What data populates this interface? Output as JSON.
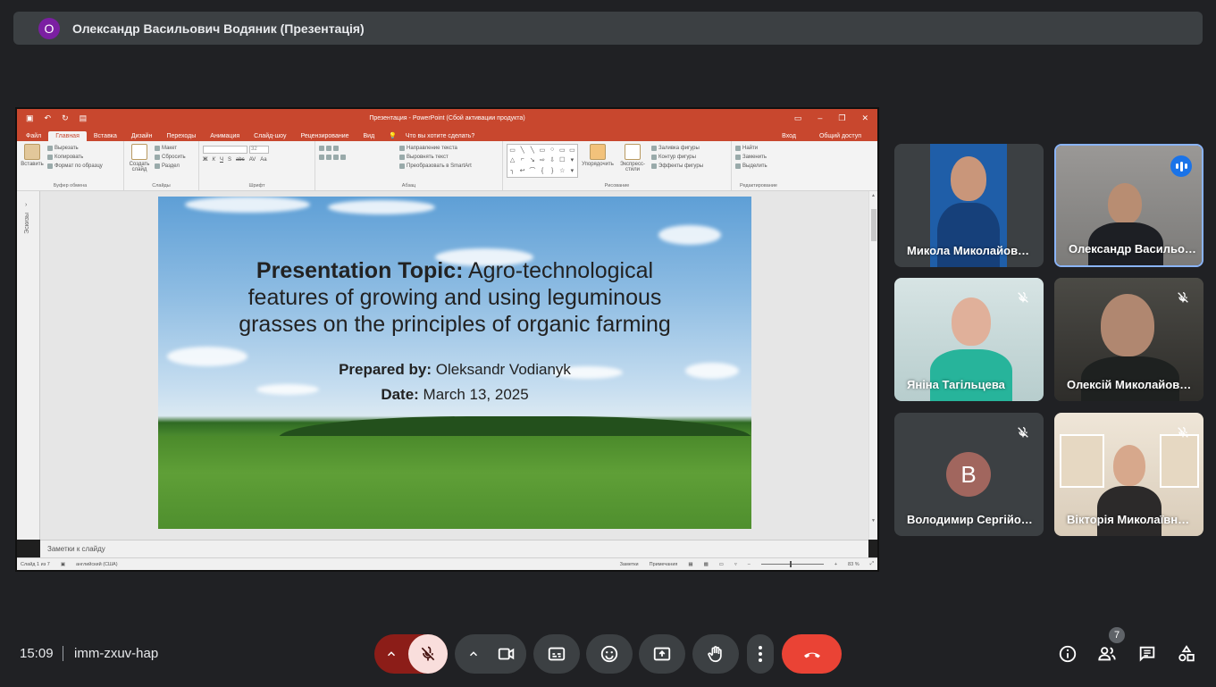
{
  "banner": {
    "avatar_letter": "О",
    "title": "Олександр Васильович Водяник (Презентація)"
  },
  "ppt": {
    "window_title": "Презентация - PowerPoint (Сбой активации продукта)",
    "tabs": [
      "Файл",
      "Главная",
      "Вставка",
      "Дизайн",
      "Переходы",
      "Анимация",
      "Слайд-шоу",
      "Рецензирование",
      "Вид",
      "Что вы хотите сделать?"
    ],
    "tabs_right": [
      "Вход",
      "Общий доступ"
    ],
    "clipboard": {
      "paste": "Вставить",
      "cut": "Вырезать",
      "copy": "Копировать",
      "format": "Формат по образцу",
      "label": "Буфер обмена"
    },
    "slides": {
      "new": "Создать слайд",
      "layout": "Макет",
      "reset": "Сбросить",
      "section": "Раздел",
      "label": "Слайды"
    },
    "font": {
      "size": "32",
      "label": "Шрифт",
      "bold": "Ж",
      "italic": "К",
      "underline": "Ч",
      "shadow": "S",
      "strike": "abc",
      "spacing": "AV",
      "case": "Aa"
    },
    "paragraph": {
      "direction": "Направление текста",
      "align": "Выровнять текст",
      "smartart": "Преобразовать в SmartArt",
      "label": "Абзац"
    },
    "drawing": {
      "arrange": "Упорядочить",
      "styles": "Экспресс-стили",
      "fill": "Заливка фигуры",
      "outline": "Контур фигуры",
      "effects": "Эффекты фигуры",
      "label": "Рисование"
    },
    "editing": {
      "find": "Найти",
      "replace": "Заменить",
      "select": "Выделить",
      "label": "Редактирование"
    },
    "thumbs_label": "Эскизы",
    "notes": "Заметки к слайду",
    "status": {
      "slide": "Слайд 1 из 7",
      "lang": "английский (США)",
      "notes": "Заметки",
      "comments": "Примечания",
      "zoom": "83 %"
    }
  },
  "slide": {
    "topic_bold": "Presentation Topic:",
    "topic_line1_rest": " Agro-technological",
    "topic_line2": "features of growing and using leguminous",
    "topic_line3": "grasses on the principles of organic farming",
    "prep_bold": "Prepared by:",
    "prep_name": " Oleksandr Vodianyk",
    "date_bold": "Date:",
    "date_val": " March 13, 2025"
  },
  "participants": [
    {
      "name": "Микола Миколайов…",
      "muted": false
    },
    {
      "name": "Олександр Васильо…",
      "speaking": true
    },
    {
      "name": "Яніна Тагільцева",
      "muted": true
    },
    {
      "name": "Олексій Миколайов…",
      "muted": true
    },
    {
      "name": "Володимир Сергійо…",
      "muted": true,
      "avatar_letter": "В"
    },
    {
      "name": "Вікторія Миколаївн…",
      "muted": true
    }
  ],
  "bottom": {
    "time": "15:09",
    "meeting_code": "imm-zxuv-hap",
    "participants_count": "7",
    "icons": [
      "chevron-up-icon",
      "mic-off-icon",
      "videocam-icon",
      "captions-icon",
      "emoji-icon",
      "present-icon",
      "hand-icon",
      "more-icon",
      "call-end-icon",
      "info-icon",
      "people-icon",
      "chat-icon",
      "activities-icon"
    ]
  },
  "colors": {
    "background": "#202124",
    "tile": "#3c4043",
    "end_call": "#ea4335",
    "mic_muted": "#8c1d18",
    "speaking": "#1a73e8",
    "ppt_brand": "#c8472e"
  }
}
